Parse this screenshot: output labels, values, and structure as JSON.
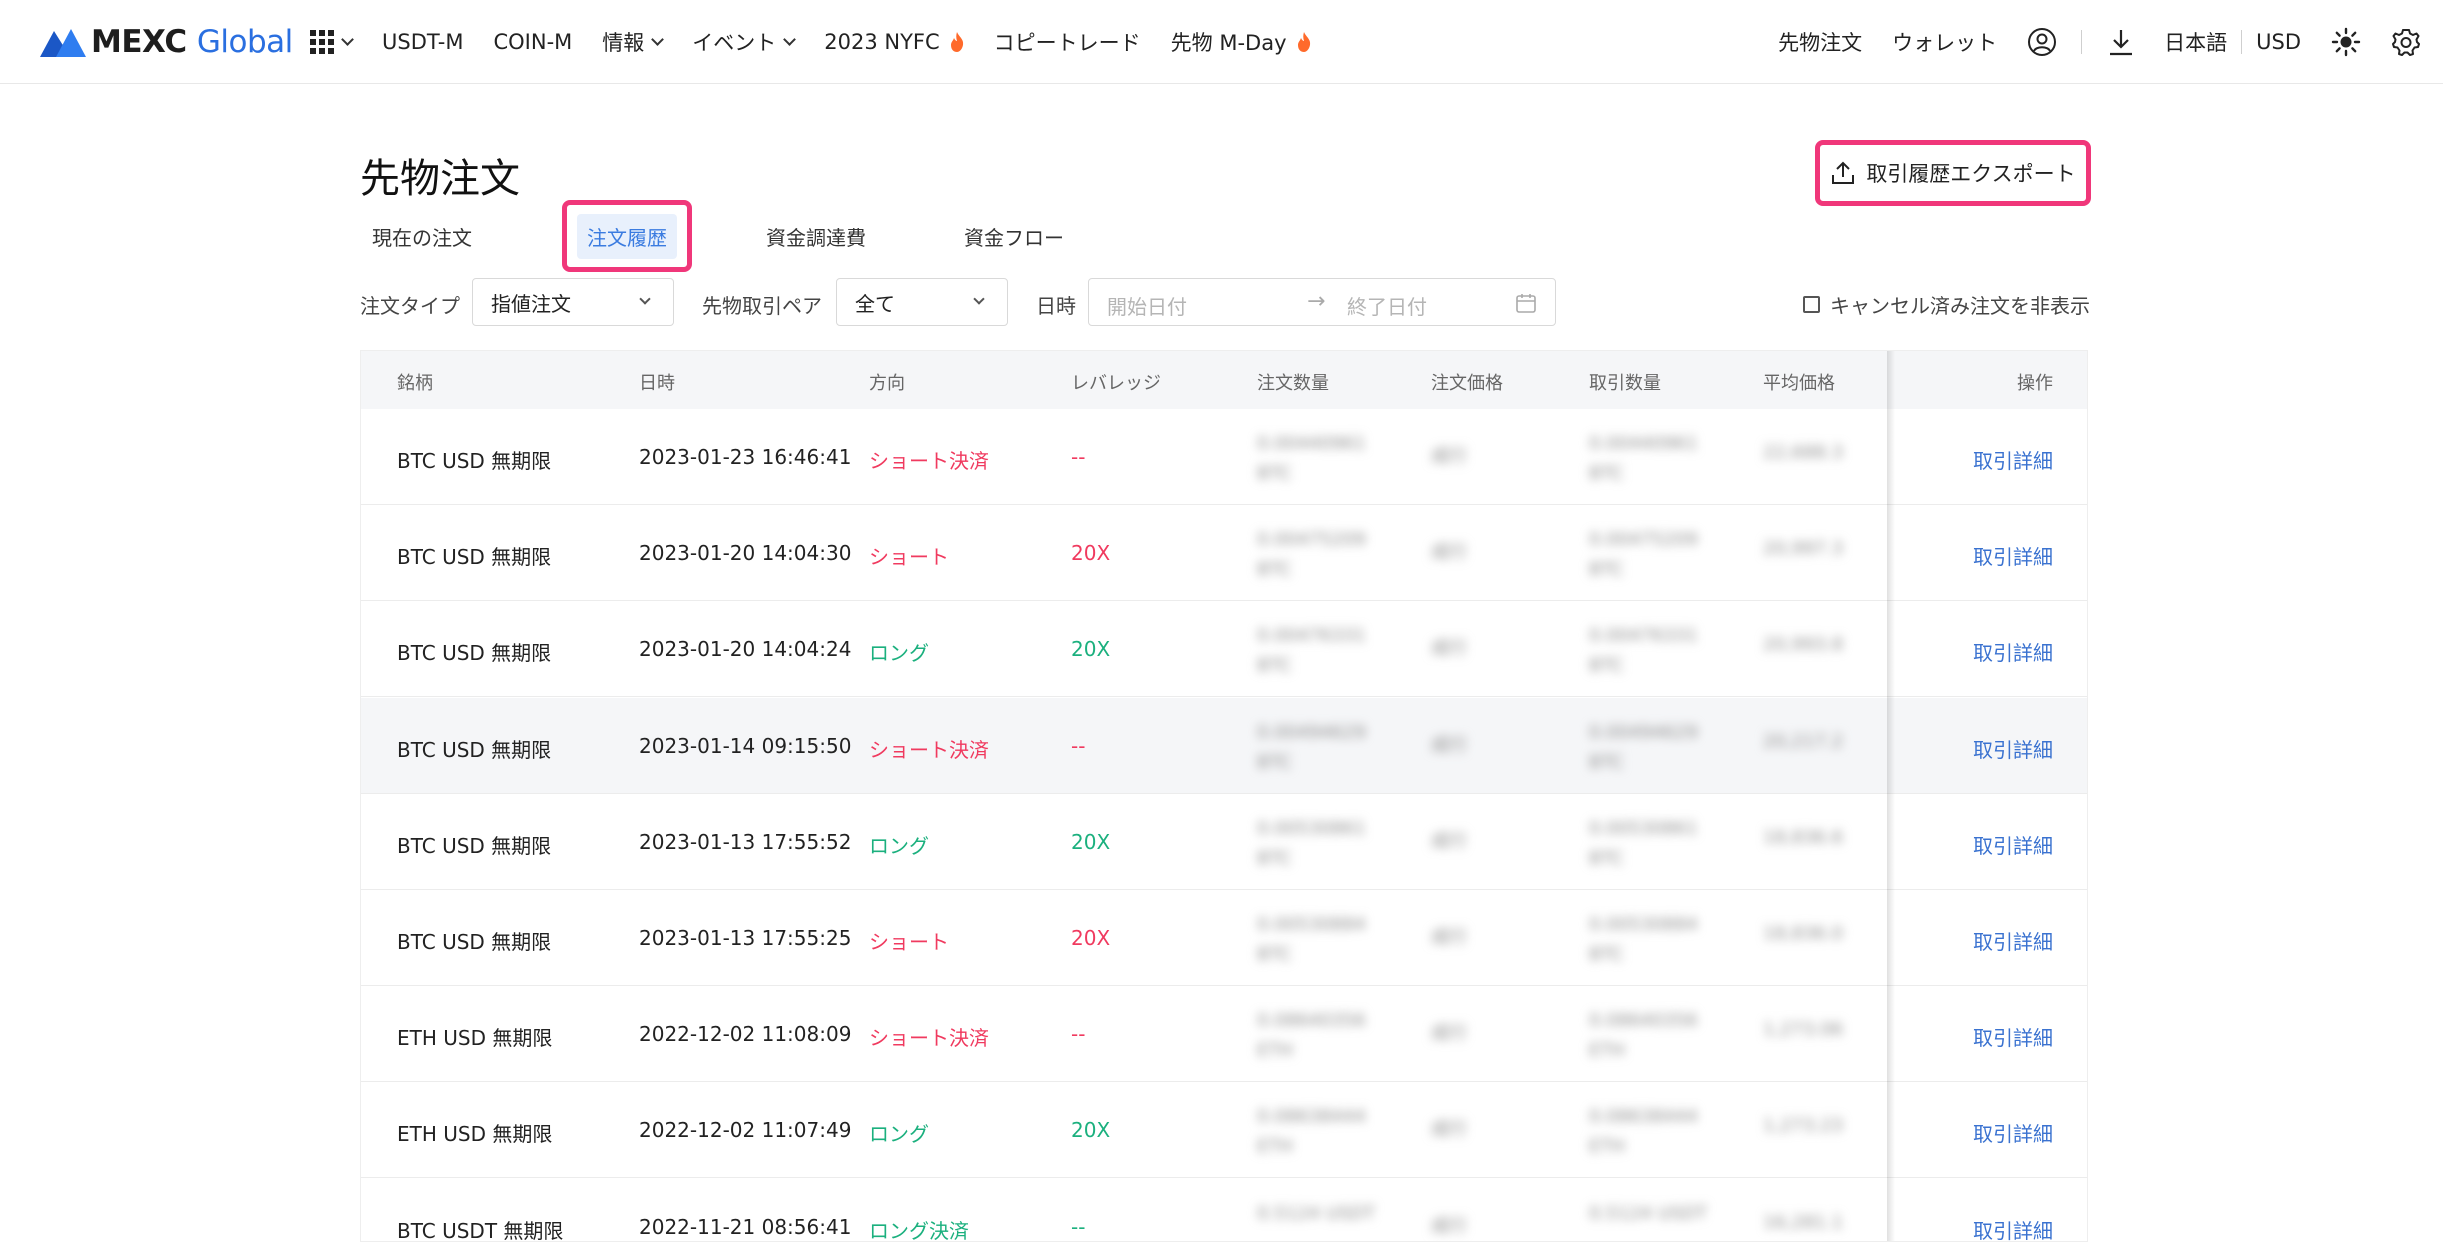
{
  "nav": {
    "logo_brand": "MEXC",
    "logo_suffix": "Global",
    "items": [
      {
        "label": "USDT-M"
      },
      {
        "label": "COIN-M"
      },
      {
        "label": "情報"
      },
      {
        "label": "イベント"
      },
      {
        "label": "2023 NYFC"
      },
      {
        "label": "コピートレード"
      },
      {
        "label": "先物 M-Day"
      }
    ],
    "right": {
      "futures_orders": "先物注文",
      "wallet": "ウォレット",
      "language": "日本語",
      "currency": "USD"
    }
  },
  "page": {
    "title": "先物注文",
    "export_label": "取引履歴エクスポート",
    "tabs": [
      {
        "label": "現在の注文"
      },
      {
        "label": "注文履歴"
      },
      {
        "label": "資金調達費"
      },
      {
        "label": "資金フロー"
      }
    ]
  },
  "filters": {
    "order_type_label": "注文タイプ",
    "order_type_value": "指値注文",
    "pair_label": "先物取引ペア",
    "pair_value": "全て",
    "date_label": "日時",
    "start_placeholder": "開始日付",
    "end_placeholder": "終了日付",
    "hide_cancelled": "キャンセル済み注文を非表示"
  },
  "table": {
    "headers": {
      "symbol": "銘柄",
      "time": "日時",
      "side": "方向",
      "leverage": "レバレッジ",
      "order_qty": "注文数量",
      "order_price": "注文価格",
      "filled_qty": "取引数量",
      "avg_price": "平均価格",
      "action": "操作"
    },
    "rows": [
      {
        "symbol": "BTC USD 無期限",
        "time": "2023-01-23 16:46:41",
        "side": "ショート決済",
        "side_type": "sell",
        "leverage": "--",
        "order_qty": "0.00440961",
        "order_unit": "BTC",
        "order_price": "成行",
        "filled_qty": "0.00440961",
        "filled_unit": "BTC",
        "avg_price": "22,688.3",
        "action": "取引詳細"
      },
      {
        "symbol": "BTC USD 無期限",
        "time": "2023-01-20 14:04:30",
        "side": "ショート",
        "side_type": "sell",
        "leverage": "20X",
        "order_qty": "0.00475209",
        "order_unit": "BTC",
        "order_price": "成行",
        "filled_qty": "0.00475209",
        "filled_unit": "BTC",
        "avg_price": "20,997.3",
        "action": "取引詳細"
      },
      {
        "symbol": "BTC USD 無期限",
        "time": "2023-01-20 14:04:24",
        "side": "ロング",
        "side_type": "buy",
        "leverage": "20X",
        "order_qty": "0.00476331",
        "order_unit": "BTC",
        "order_price": "成行",
        "filled_qty": "0.00476331",
        "filled_unit": "BTC",
        "avg_price": "20,993.8",
        "action": "取引詳細"
      },
      {
        "symbol": "BTC USD 無期限",
        "time": "2023-01-14 09:15:50",
        "side": "ショート決済",
        "side_type": "sell",
        "leverage": "--",
        "order_qty": "0.00494629",
        "order_unit": "BTC",
        "order_price": "成行",
        "filled_qty": "0.00494629",
        "filled_unit": "BTC",
        "avg_price": "20,217.2",
        "action": "取引詳細"
      },
      {
        "symbol": "BTC USD 無期限",
        "time": "2023-01-13 17:55:52",
        "side": "ロング",
        "side_type": "buy",
        "leverage": "20X",
        "order_qty": "0.00530861",
        "order_unit": "BTC",
        "order_price": "成行",
        "filled_qty": "0.00530861",
        "filled_unit": "BTC",
        "avg_price": "18,836.6",
        "action": "取引詳細"
      },
      {
        "symbol": "BTC USD 無期限",
        "time": "2023-01-13 17:55:25",
        "side": "ショート",
        "side_type": "sell",
        "leverage": "20X",
        "order_qty": "0.00530884",
        "order_unit": "BTC",
        "order_price": "成行",
        "filled_qty": "0.00530884",
        "filled_unit": "BTC",
        "avg_price": "18,836.0",
        "action": "取引詳細"
      },
      {
        "symbol": "ETH USD 無期限",
        "time": "2022-12-02 11:08:09",
        "side": "ショート決済",
        "side_type": "sell",
        "leverage": "--",
        "order_qty": "0.08640356",
        "order_unit": "ETH",
        "order_price": "成行",
        "filled_qty": "0.08640356",
        "filled_unit": "ETH",
        "avg_price": "1,273.06",
        "action": "取引詳細"
      },
      {
        "symbol": "ETH USD 無期限",
        "time": "2022-12-02 11:07:49",
        "side": "ロング",
        "side_type": "buy",
        "leverage": "20X",
        "order_qty": "0.08638444",
        "order_unit": "ETH",
        "order_price": "成行",
        "filled_qty": "0.08638444",
        "filled_unit": "ETH",
        "avg_price": "1,273.23",
        "action": "取引詳細"
      },
      {
        "symbol": "BTC USDT 無期限",
        "time": "2022-11-21 08:56:41",
        "side": "ロング決済",
        "side_type": "buy",
        "leverage": "--",
        "order_qty": "0.5124 USDT",
        "order_unit": "",
        "order_price": "成行",
        "filled_qty": "0.5124 USDT",
        "filled_unit": "",
        "avg_price": "16,281.1",
        "action": "取引詳細"
      }
    ]
  }
}
